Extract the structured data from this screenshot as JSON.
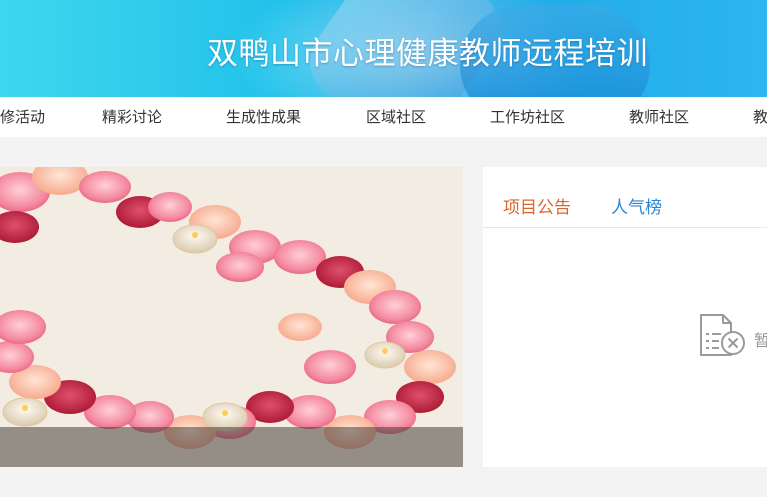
{
  "banner": {
    "title": "双鸭山市心理健康教师远程培训"
  },
  "nav": {
    "items": [
      {
        "label": "修活动",
        "name": "nav-item-training-activity"
      },
      {
        "label": "精彩讨论",
        "name": "nav-item-discussion"
      },
      {
        "label": "生成性成果",
        "name": "nav-item-results"
      },
      {
        "label": "区域社区",
        "name": "nav-item-regional-community"
      },
      {
        "label": "工作坊社区",
        "name": "nav-item-workshop-community"
      },
      {
        "label": "教师社区",
        "name": "nav-item-teacher-community"
      },
      {
        "label": "教",
        "name": "nav-item-more"
      }
    ]
  },
  "panel": {
    "tabs": [
      {
        "label": "项目公告"
      },
      {
        "label": "人气榜"
      }
    ],
    "empty_text": "暂"
  },
  "colors": {
    "accent_tab": "#d9662e",
    "link_tab": "#2a84d8",
    "banner": "#22c2ea"
  }
}
